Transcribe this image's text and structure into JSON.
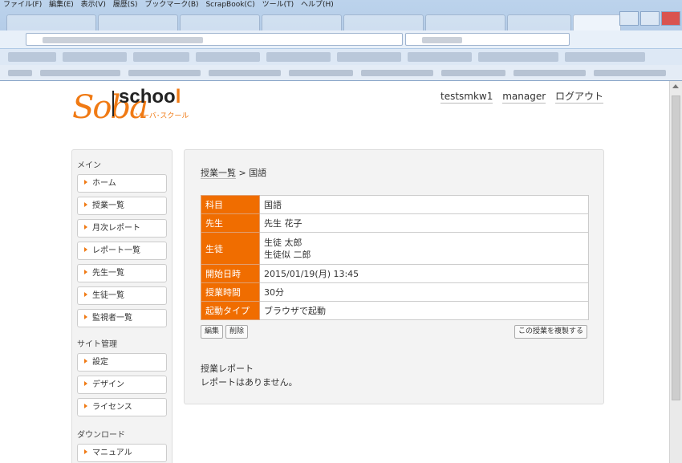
{
  "browser": {
    "menu": [
      "ファイル(F)",
      "編集(E)",
      "表示(V)",
      "履歴(S)",
      "ブックマーク(B)",
      "ScrapBook(C)",
      "ツール(T)",
      "ヘルプ(H)"
    ]
  },
  "header": {
    "logo_soba": "Soba",
    "logo_school": "school",
    "logo_kana": "ソーバ･スクール",
    "user": "testsmkw1",
    "manager_link": "manager",
    "logout_link": "ログアウト"
  },
  "sidebar": {
    "main_title": "メイン",
    "main_items": [
      "ホーム",
      "授業一覧",
      "月次レポート",
      "レポート一覧",
      "先生一覧",
      "生徒一覧",
      "監視者一覧"
    ],
    "admin_title": "サイト管理",
    "admin_items": [
      "設定",
      "デザイン",
      "ライセンス"
    ],
    "download_title": "ダウンロード",
    "download_items": [
      "マニュアル"
    ]
  },
  "main": {
    "breadcrumb_link": "授業一覧",
    "breadcrumb_sep": " > ",
    "breadcrumb_current": "国語",
    "rows": [
      {
        "key": "科目",
        "value": "国語"
      },
      {
        "key": "先生",
        "value": "先生 花子"
      },
      {
        "key": "生徒",
        "value": "生徒 太郎",
        "value2": "生徒似 二郎"
      },
      {
        "key": "開始日時",
        "value": "2015/01/19(月) 13:45"
      },
      {
        "key": "授業時間",
        "value": "30分"
      },
      {
        "key": "起動タイプ",
        "value": "ブラウザで起動"
      }
    ],
    "edit_button": "編集",
    "delete_button": "削除",
    "copy_button": "この授業を複製する",
    "report_title": "授業レポート",
    "report_empty": "レポートはありません。"
  },
  "colors": {
    "accent": "#f06d00",
    "logo_orange": "#f07a14"
  }
}
